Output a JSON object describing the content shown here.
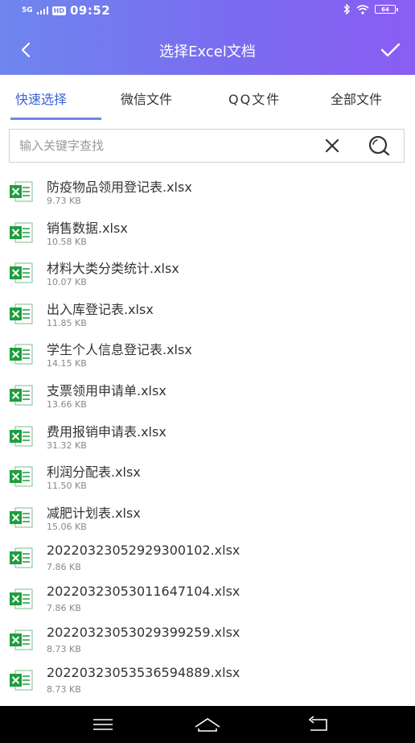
{
  "status_bar": {
    "network": "5G",
    "hd": "HD",
    "time": "09:52",
    "battery": "64"
  },
  "header": {
    "title": "选择Excel文档",
    "back_icon": "chevron-left-icon",
    "confirm_icon": "check-icon"
  },
  "colors": {
    "header_start": "#6e86ee",
    "header_end": "#8a5df2",
    "tab_active": "#3d63d8",
    "excel_green": "#1e9e3e"
  },
  "tabs": [
    {
      "label": "快速选择",
      "active": true
    },
    {
      "label": "微信文件",
      "active": false
    },
    {
      "label": "QQ文件",
      "active": false
    },
    {
      "label": "全部文件",
      "active": false
    }
  ],
  "search": {
    "placeholder": "输入关键字查找",
    "value": ""
  },
  "files": [
    {
      "name": "防疫物品领用登记表.xlsx",
      "size": "9.73 KB"
    },
    {
      "name": "销售数据.xlsx",
      "size": "10.58 KB"
    },
    {
      "name": "材料大类分类统计.xlsx",
      "size": "10.07 KB"
    },
    {
      "name": "出入库登记表.xlsx",
      "size": "11.85 KB"
    },
    {
      "name": "学生个人信息登记表.xlsx",
      "size": "14.15 KB"
    },
    {
      "name": "支票领用申请单.xlsx",
      "size": "13.66 KB"
    },
    {
      "name": "费用报销申请表.xlsx",
      "size": "31.32 KB"
    },
    {
      "name": "利润分配表.xlsx",
      "size": "11.50 KB"
    },
    {
      "name": "减肥计划表.xlsx",
      "size": "15.06 KB"
    },
    {
      "name": "20220323052929300102.xlsx",
      "size": "7.86 KB"
    },
    {
      "name": "20220323053011647104.xlsx",
      "size": "7.86 KB"
    },
    {
      "name": "20220323053029399259.xlsx",
      "size": "8.73 KB"
    },
    {
      "name": "20220323053536594889.xlsx",
      "size": "8.73 KB"
    }
  ]
}
